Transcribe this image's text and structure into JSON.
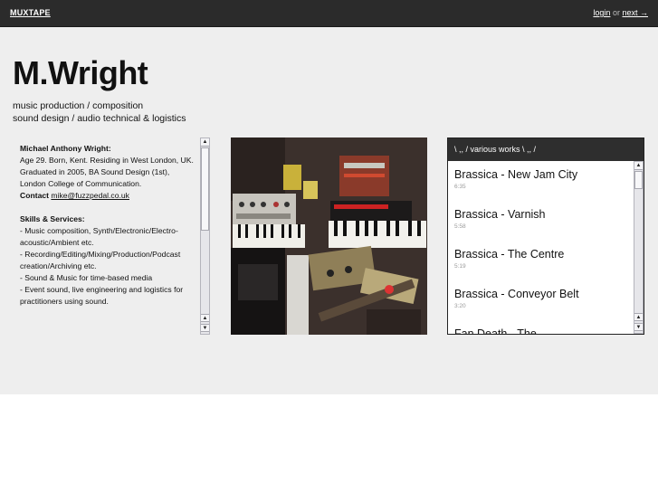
{
  "topbar": {
    "brand": "MUXTAPE",
    "login": "login",
    "or": "or",
    "next": "next →"
  },
  "header": {
    "title": "M.Wright",
    "tagline1": "music production / composition",
    "tagline2": "sound design / audio technical & logistics"
  },
  "bio": {
    "name": "Michael Anthony Wright:",
    "line1": "Age 29. Born, Kent. Residing in West London, UK.",
    "line2": "Graduated in 2005, BA Sound Design (1st), London College of Communication.",
    "contact_label": "Contact",
    "email": "mike@fuzzpedal.co.uk",
    "skills_heading": "Skills & Services:",
    "skills": [
      "- Music composition, Synth/Electronic/Electro-acoustic/Ambient etc.",
      "- Recording/Editing/Mixing/Production/Podcast creation/Archiving etc.",
      "- Sound & Music for time-based media",
      "- Event sound, live engineering and logistics for practitioners using sound."
    ]
  },
  "playlist": {
    "heading": "\\ ,, / various works \\ ,, /",
    "tracks": [
      {
        "title": "Brassica - New Jam City",
        "time": "6:35"
      },
      {
        "title": "Brassica - Varnish",
        "time": "5:58"
      },
      {
        "title": "Brassica - The Centre",
        "time": "5:19"
      },
      {
        "title": "Brassica - Conveyor Belt",
        "time": "3:20"
      },
      {
        "title": "Fan Death - The",
        "time": ""
      }
    ]
  },
  "colors": {
    "topbar": "#2b2b2b",
    "page_bg": "#eeeeee",
    "playlist_header": "#2e2e2e"
  }
}
